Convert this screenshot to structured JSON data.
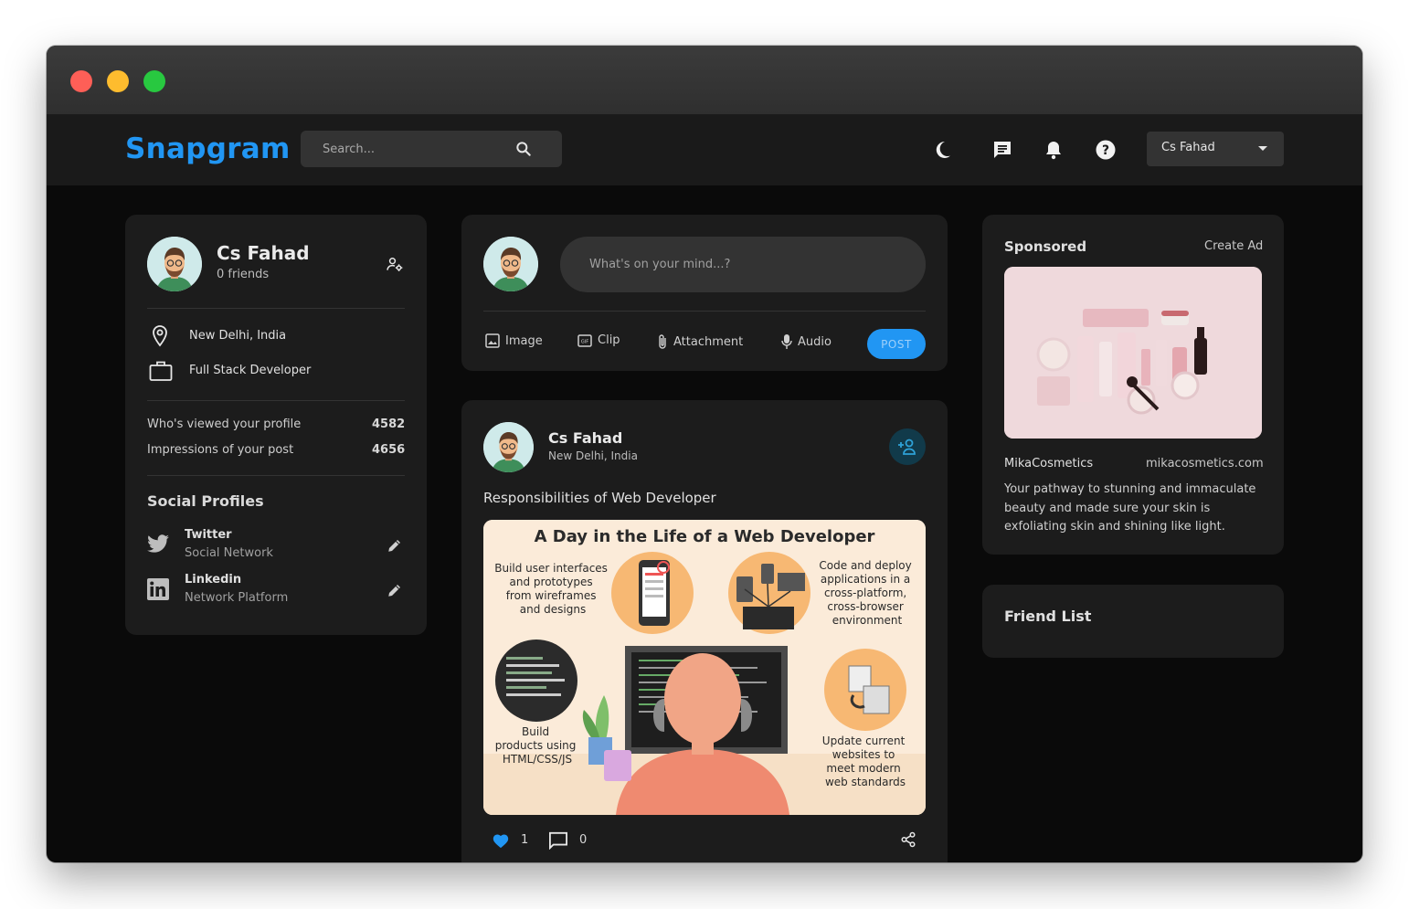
{
  "window": {
    "title": ""
  },
  "navbar": {
    "logo": "Snapgram",
    "search_placeholder": "Search...",
    "user_name": "Cs Fahad",
    "icons": [
      "moon-icon",
      "message-icon",
      "bell-icon",
      "help-icon",
      "search-icon"
    ]
  },
  "profile": {
    "name": "Cs Fahad",
    "friends": "0 friends",
    "location": "New Delhi, India",
    "occupation": "Full Stack Developer",
    "stats": [
      {
        "label": "Who's viewed your profile",
        "value": "4582"
      },
      {
        "label": "Impressions of your post",
        "value": "4656"
      }
    ],
    "social_title": "Social Profiles",
    "socials": [
      {
        "name": "Twitter",
        "type": "Social Network"
      },
      {
        "name": "Linkedin",
        "type": "Network Platform"
      }
    ]
  },
  "composer": {
    "placeholder": "What's on your mind...?",
    "tools": [
      "Image",
      "Clip",
      "Attachment",
      "Audio"
    ],
    "post_label": "POST"
  },
  "post": {
    "author": "Cs Fahad",
    "location": "New Delhi, India",
    "caption": "Responsibilities of Web Developer",
    "image": {
      "title": "A Day in the Life of a Web Developer",
      "items": [
        "Build user interfaces and prototypes from wireframes and designs",
        "Code and deploy applications in a cross-platform, cross-browser environment",
        "Build products using HTML/CSS/JS",
        "Update current websites to meet modern web standards"
      ]
    },
    "likes": "1",
    "comments": "0"
  },
  "sponsored": {
    "title": "Sponsored",
    "create_ad": "Create Ad",
    "brand": "MikaCosmetics",
    "site": "mikacosmetics.com",
    "description": "Your pathway to stunning and immaculate beauty and made sure your skin is exfoliating skin and shining like light."
  },
  "friend_list": {
    "title": "Friend List"
  },
  "colors": {
    "accent": "#2196f3",
    "background": "#0a0a0a",
    "card": "#1c1c1c",
    "navbar": "#1a1a1a"
  }
}
